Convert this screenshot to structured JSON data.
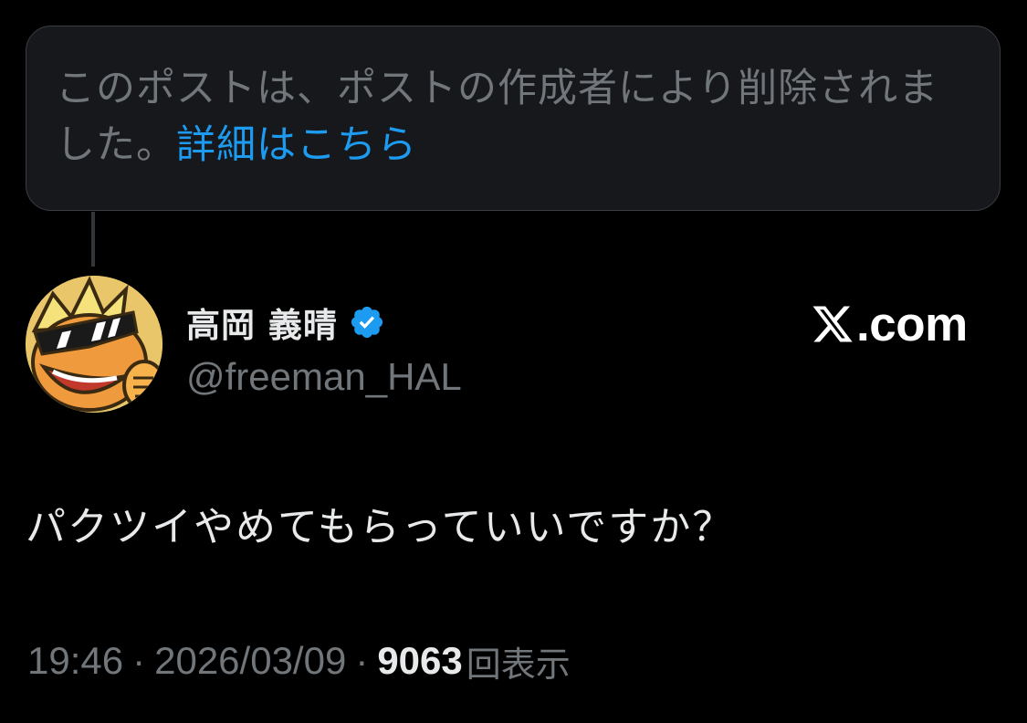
{
  "deleted_notice": {
    "text": "このポストは、ポストの作成者により削除されました。",
    "link_label": "詳細はこちら"
  },
  "author": {
    "display_name": "高岡 義晴",
    "handle": "@freeman_HAL",
    "verified": true,
    "avatar_icon": "cartoon-avatar-icon"
  },
  "brand": {
    "domain": ".com",
    "mark_icon": "x-logo-icon"
  },
  "post": {
    "text": "パクツイやめてもらっていいですか？"
  },
  "meta": {
    "time": "19:46",
    "date": "2026/03/09",
    "separator": "·",
    "views_count": "9063",
    "views_label": "回表示"
  },
  "colors": {
    "background": "#000000",
    "card": "#16181c",
    "muted_text": "#71767b",
    "primary_text": "#e7e9ea",
    "link": "#1d9bf0",
    "verified": "#1d9bf0"
  }
}
